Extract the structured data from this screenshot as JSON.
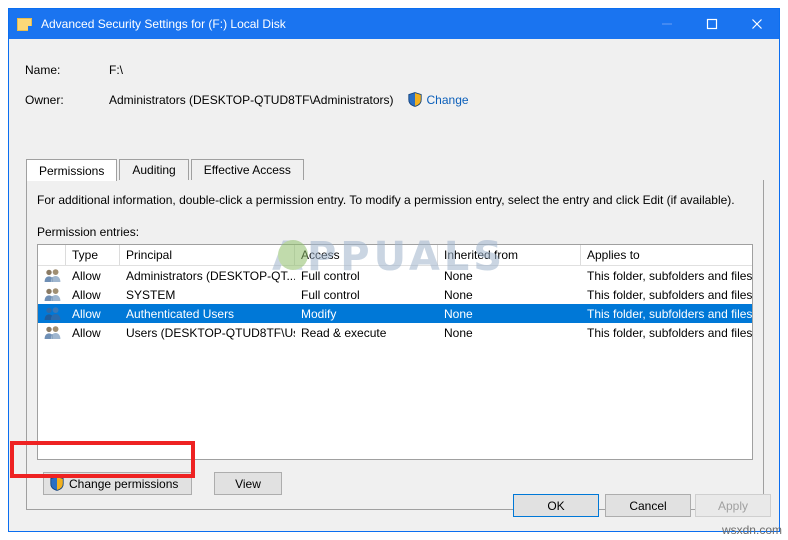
{
  "window": {
    "title": "Advanced Security Settings for (F:) Local Disk",
    "folder_icon": "folder-icon",
    "controls": {
      "minimize": "minimize-icon",
      "maximize": "maximize-icon",
      "close": "close-icon"
    },
    "titlebar_color": "#1a74f0"
  },
  "header": {
    "name_label": "Name:",
    "name_value": "F:\\",
    "owner_label": "Owner:",
    "owner_value": "Administrators (DESKTOP-QTUD8TF\\Administrators)",
    "change_link": "Change",
    "change_shield_icon": "uac-shield-icon"
  },
  "tabs": [
    {
      "label": "Permissions",
      "active": true
    },
    {
      "label": "Auditing",
      "active": false
    },
    {
      "label": "Effective Access",
      "active": false
    }
  ],
  "page": {
    "info_text": "For additional information, double-click a permission entry. To modify a permission entry, select the entry and click Edit (if available).",
    "entries_label": "Permission entries:"
  },
  "table": {
    "columns": [
      "",
      "Type",
      "Principal",
      "Access",
      "Inherited from",
      "Applies to"
    ],
    "rows": [
      {
        "icon": "users-group-icon",
        "type": "Allow",
        "principal": "Administrators (DESKTOP-QT...",
        "access": "Full control",
        "inherited_from": "None",
        "applies_to": "This folder, subfolders and files",
        "selected": false
      },
      {
        "icon": "users-group-icon",
        "type": "Allow",
        "principal": "SYSTEM",
        "access": "Full control",
        "inherited_from": "None",
        "applies_to": "This folder, subfolders and files",
        "selected": false
      },
      {
        "icon": "users-group-icon",
        "type": "Allow",
        "principal": "Authenticated Users",
        "access": "Modify",
        "inherited_from": "None",
        "applies_to": "This folder, subfolders and files",
        "selected": true
      },
      {
        "icon": "users-group-icon",
        "type": "Allow",
        "principal": "Users (DESKTOP-QTUD8TF\\Us...",
        "access": "Read & execute",
        "inherited_from": "None",
        "applies_to": "This folder, subfolders and files",
        "selected": false
      }
    ],
    "selection_color": "#0078d7"
  },
  "actions": {
    "change_permissions": "Change permissions",
    "change_permissions_shield_icon": "uac-shield-icon",
    "view": "View"
  },
  "footer": {
    "ok": "OK",
    "cancel": "Cancel",
    "apply": "Apply",
    "apply_disabled": true
  },
  "annotations": {
    "highlight_color": "#ee2222",
    "highlight_target": "change-permissions-button"
  },
  "watermarks": {
    "center": "APPUALS",
    "corner": "wsxdn.com"
  }
}
